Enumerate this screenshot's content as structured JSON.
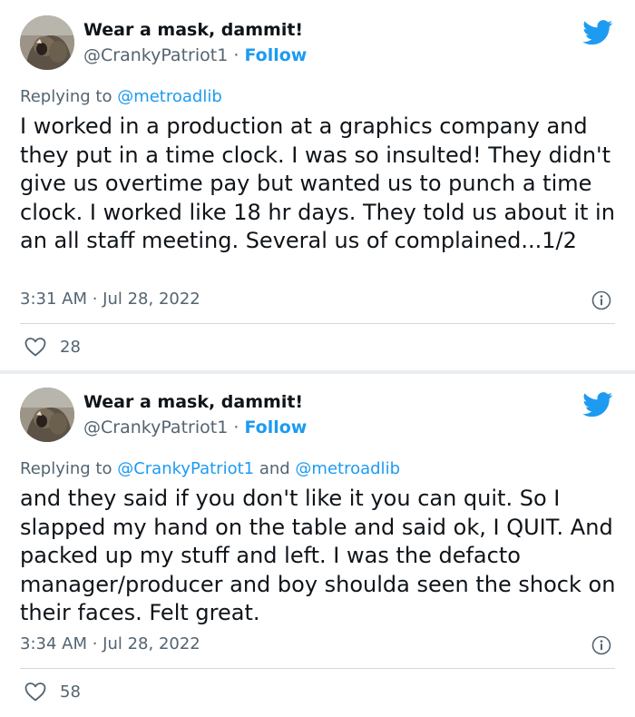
{
  "tweets": [
    {
      "display_name": "Wear a mask, dammit!",
      "handle": "@CrankyPatriot1",
      "dot": "·",
      "follow_label": "Follow",
      "replying_prefix": "Replying to ",
      "reply_to": "@metroadlib",
      "reply_joiner": "",
      "reply_to_2": "",
      "text": "I worked in a production at a graphics company and they put in a time clock. I was so insulted! They didn't give us overtime pay but wanted us to punch a time clock. I worked like 18 hr days. They told us about it in an all staff meeting. Several us of complained...1/2",
      "timestamp": "3:31 AM · Jul 28, 2022",
      "likes": "28"
    },
    {
      "display_name": "Wear a mask, dammit!",
      "handle": "@CrankyPatriot1",
      "dot": "·",
      "follow_label": "Follow",
      "replying_prefix": "Replying to ",
      "reply_to": "@CrankyPatriot1",
      "reply_joiner": " and ",
      "reply_to_2": "@metroadlib",
      "text": "and they said if you don't like it you can quit. So I slapped my hand on the table and said ok, I QUIT. And packed up my stuff and left. I was the defacto manager/producer and boy shoulda seen the shock on their faces. Felt great.",
      "timestamp": "3:34 AM · Jul 28, 2022",
      "likes": "58"
    }
  ],
  "colors": {
    "brand_blue": "#1d9bf0",
    "text_primary": "#0f1419",
    "text_secondary": "#536471",
    "divider": "#cfd9de"
  },
  "icons": [
    "avatar-image",
    "twitter-bird-icon",
    "info-icon",
    "heart-icon"
  ]
}
